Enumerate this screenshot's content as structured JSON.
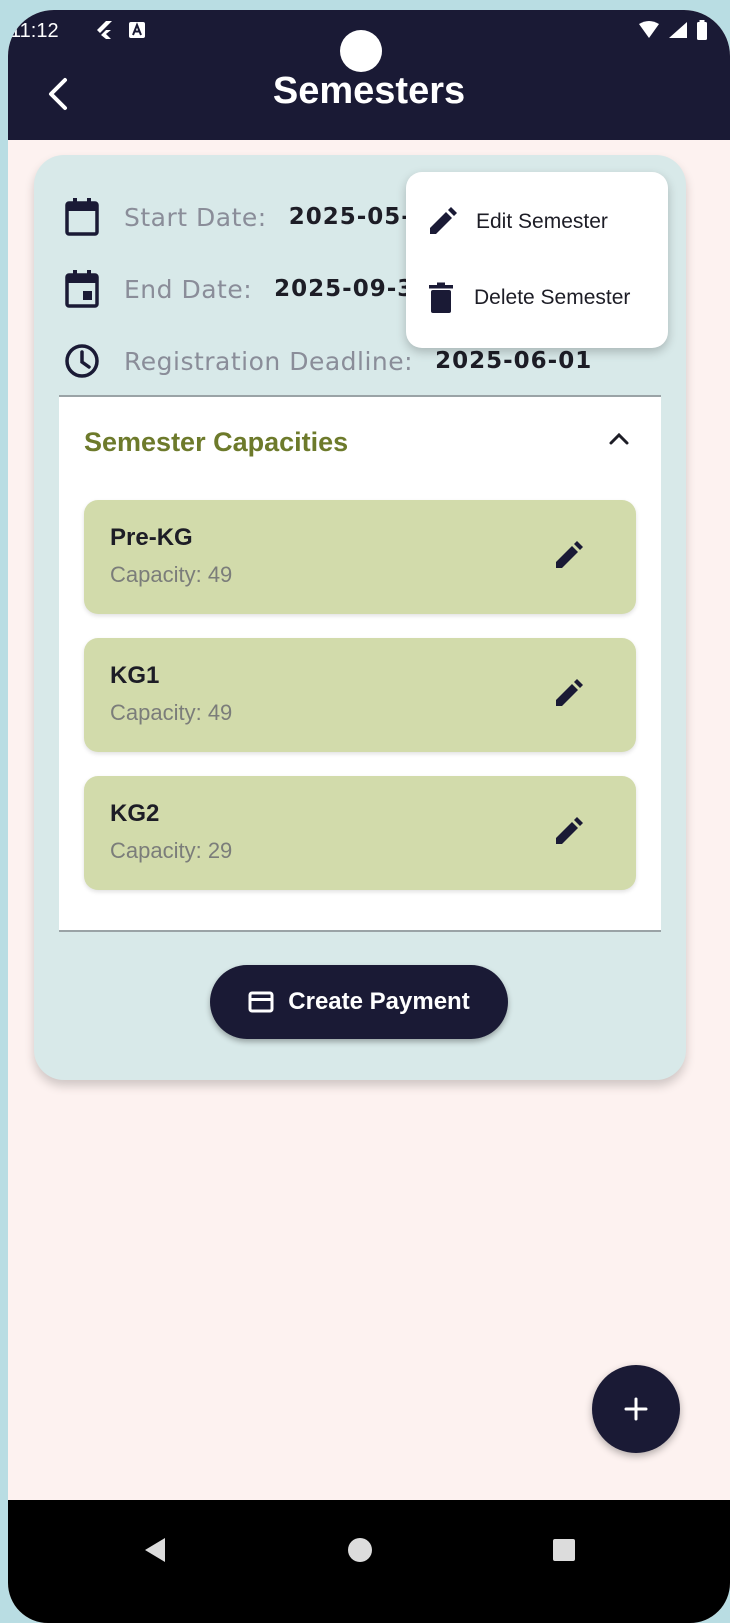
{
  "status_bar": {
    "time": "11:12",
    "left_icons": [
      "flutter-icon",
      "a-badge-icon"
    ],
    "right_icons": [
      "wifi-icon",
      "signal-icon",
      "battery-icon"
    ]
  },
  "app_bar": {
    "title": "Semesters",
    "back_icon": "chevron-left-icon"
  },
  "semester": {
    "start_date_label": "Start Date:",
    "start_date_value": "2025-05-",
    "end_date_label": "End Date:",
    "end_date_value": "2025-09-3",
    "registration_label": "Registration Deadline:",
    "registration_value": "2025-06-01"
  },
  "capacities": {
    "title": "Semester Capacities",
    "items": [
      {
        "name": "Pre-KG",
        "capacity": "Capacity: 49"
      },
      {
        "name": "KG1",
        "capacity": "Capacity: 49"
      },
      {
        "name": "KG2",
        "capacity": "Capacity: 29"
      }
    ]
  },
  "actions": {
    "create_payment": "Create Payment"
  },
  "context_menu": {
    "edit": "Edit Semester",
    "delete": "Delete Semester"
  },
  "fab": {
    "icon": "plus-icon"
  },
  "colors": {
    "app_bar": "#1a1a35",
    "page_bg": "#fdf2f0",
    "card_bg": "#d8e9e9",
    "capacity_item_bg": "#d2dbab",
    "section_title": "#6d7a2b"
  }
}
